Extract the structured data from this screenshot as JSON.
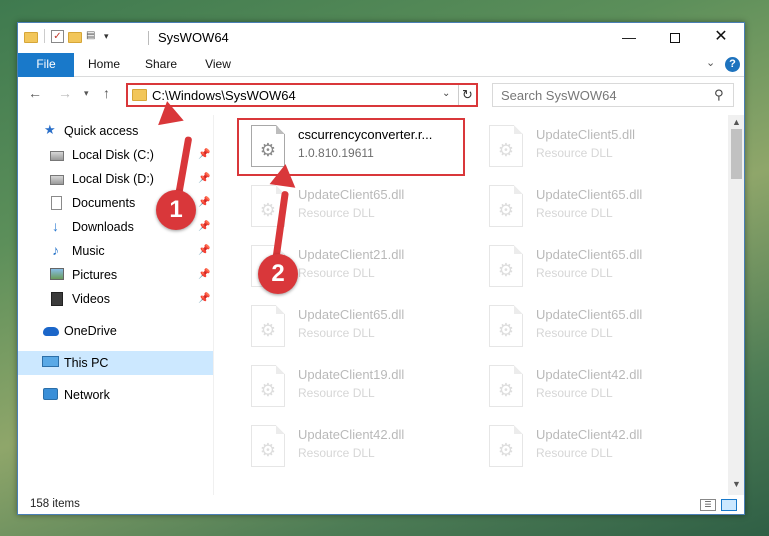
{
  "window": {
    "title": "SysWOW64",
    "minimize_glyph": "—",
    "close_glyph": "✕"
  },
  "quick_access_toolbar": {
    "check_glyph": "✓",
    "props_glyph": "▤",
    "dropdown_glyph": "▾"
  },
  "ribbon": {
    "tabs": [
      "File",
      "Home",
      "Share",
      "View"
    ],
    "active_tab": "File",
    "active_color": "#1979ca",
    "collapse_glyph": "⌄",
    "help_label": "?"
  },
  "navigation": {
    "back_glyph": "←",
    "forward_glyph": "→",
    "recent_glyph": "▾",
    "up_glyph": "↑",
    "address_path": "C:\\Windows\\SysWOW64",
    "address_dropdown_glyph": "⌄",
    "refresh_glyph": "↻",
    "search_placeholder": "Search SysWOW64",
    "search_glyph": "⚲"
  },
  "sidebar": {
    "pin_glyph": "📌",
    "items": [
      {
        "label": "Quick access",
        "icon": "star-icon",
        "pinned": false,
        "glyph": "★"
      },
      {
        "label": "Local Disk (C:)",
        "icon": "disk-icon",
        "pinned": true
      },
      {
        "label": "Local Disk (D:)",
        "icon": "disk-icon",
        "pinned": true
      },
      {
        "label": "Documents",
        "icon": "documents-icon",
        "pinned": true
      },
      {
        "label": "Downloads",
        "icon": "download-icon",
        "pinned": true,
        "glyph": "↓"
      },
      {
        "label": "Music",
        "icon": "music-icon",
        "pinned": true,
        "glyph": "♪"
      },
      {
        "label": "Pictures",
        "icon": "pictures-icon",
        "pinned": true
      },
      {
        "label": "Videos",
        "icon": "videos-icon",
        "pinned": true
      },
      {
        "label": "OneDrive",
        "icon": "cloud-icon",
        "pinned": false
      },
      {
        "label": "This PC",
        "icon": "computer-icon",
        "pinned": false,
        "selected": true
      },
      {
        "label": "Network",
        "icon": "network-icon",
        "pinned": false
      }
    ]
  },
  "files": {
    "gear_glyph": "⚙",
    "left_column": [
      {
        "name": "cscurrencyconverter.r...",
        "sub": "1.0.810.19611",
        "highlighted": true
      },
      {
        "name": "UpdateClient65.dll",
        "sub": "Resource DLL"
      },
      {
        "name": "UpdateClient21.dll",
        "sub": "Resource DLL"
      },
      {
        "name": "UpdateClient65.dll",
        "sub": "Resource DLL"
      },
      {
        "name": "UpdateClient19.dll",
        "sub": "Resource DLL"
      },
      {
        "name": "UpdateClient42.dll",
        "sub": "Resource DLL"
      }
    ],
    "right_column": [
      {
        "name": "UpdateClient5.dll",
        "sub": "Resource DLL"
      },
      {
        "name": "UpdateClient65.dll",
        "sub": "Resource DLL"
      },
      {
        "name": "UpdateClient65.dll",
        "sub": "Resource DLL"
      },
      {
        "name": "UpdateClient65.dll",
        "sub": "Resource DLL"
      },
      {
        "name": "UpdateClient42.dll",
        "sub": "Resource DLL"
      },
      {
        "name": "UpdateClient42.dll",
        "sub": "Resource DLL"
      }
    ]
  },
  "scrollbar": {
    "up_glyph": "▲",
    "down_glyph": "▼"
  },
  "status": {
    "item_count": "158 items",
    "details_glyph": "☰"
  },
  "annotations": {
    "badge_1": "1",
    "badge_2": "2",
    "color": "#d9373a"
  }
}
